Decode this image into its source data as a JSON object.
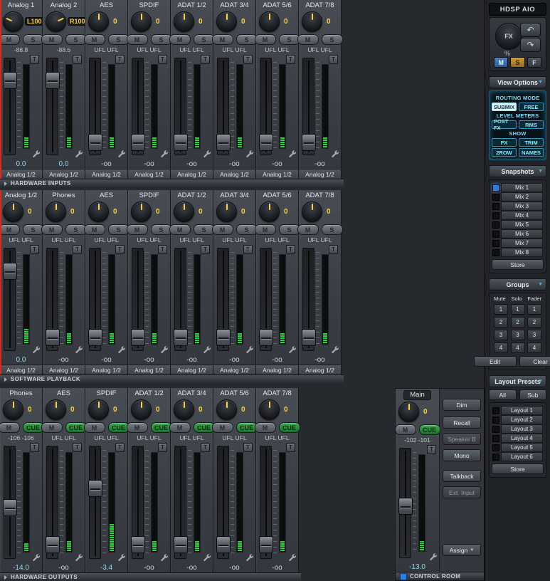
{
  "icons": {
    "dropdown": "▼",
    "undo": "↶",
    "redo": "↷"
  },
  "labels": {
    "trim": "T"
  },
  "colors": {
    "accent_cyan": "#35b6e0",
    "value_yellow": "#ffd23d",
    "gain_cyan": "#93d8ea",
    "cue_green": "#2f9a3f",
    "snapshot_led_blue": "#2f7fe0",
    "selection_red": "#cf2d1e"
  },
  "sidebar": {
    "device": "HDSP  AIO",
    "fx": {
      "label": "FX",
      "percent": "%"
    },
    "msf": [
      "M",
      "S",
      "F"
    ],
    "view_options": {
      "title": "View Options",
      "groups": [
        {
          "label": "ROUTING MODE",
          "buttons": [
            {
              "text": "SUBMIX",
              "active": true
            },
            {
              "text": "FREE"
            }
          ]
        },
        {
          "label": "LEVEL METERS",
          "buttons": [
            {
              "text": "POST FX"
            },
            {
              "text": "RMS"
            }
          ]
        },
        {
          "label": "SHOW",
          "buttons": [
            {
              "text": "FX"
            },
            {
              "text": "TRIM"
            },
            {
              "text": "2ROW"
            },
            {
              "text": "NAMES"
            }
          ]
        }
      ]
    },
    "snapshots": {
      "title": "Snapshots",
      "items": [
        "Mix 1",
        "Mix 2",
        "Mix 3",
        "Mix 4",
        "Mix 5",
        "Mix 6",
        "Mix 7",
        "Mix 8"
      ],
      "active_index": 0,
      "store": "Store"
    },
    "groups": {
      "title": "Groups",
      "columns": [
        "Mute",
        "Solo",
        "Fader"
      ],
      "rows": [
        "1",
        "2",
        "3",
        "4"
      ],
      "actions": [
        "Edit",
        "Clear"
      ]
    },
    "layout_presets": {
      "title": "Layout Presets",
      "filters": [
        "All",
        "Sub"
      ],
      "items": [
        "Layout 1",
        "Layout 2",
        "Layout 3",
        "Layout 4",
        "Layout 5",
        "Layout 6"
      ],
      "store": "Store"
    }
  },
  "sections": [
    {
      "header": "HARDWARE INPUTS",
      "channels": [
        {
          "name": "Analog 1",
          "knob": "L100",
          "buttons": [
            "M",
            "S"
          ],
          "level": "-88.8",
          "gain": "0.0",
          "out": "Analog 1/2",
          "fader_pos": 0.17,
          "meter": 0.13
        },
        {
          "name": "Analog 2",
          "knob": "R100",
          "buttons": [
            "M",
            "S"
          ],
          "level": "-88.5",
          "gain": "0.0",
          "out": "Analog 1/2",
          "fader_pos": 0.17,
          "meter": 0.13
        },
        {
          "name": "AES",
          "knob": "0",
          "buttons": [
            "M",
            "S"
          ],
          "level": "UFL UFL",
          "gain": "-oo",
          "out": "Analog 1/2",
          "fader_pos": 0.93,
          "meter": 0.12
        },
        {
          "name": "SPDIF",
          "knob": "0",
          "buttons": [
            "M",
            "S"
          ],
          "level": "UFL UFL",
          "gain": "-oo",
          "out": "Analog 1/2",
          "fader_pos": 0.93,
          "meter": 0.12
        },
        {
          "name": "ADAT 1/2",
          "knob": "0",
          "buttons": [
            "M",
            "S"
          ],
          "level": "UFL UFL",
          "gain": "-oo",
          "out": "Analog 1/2",
          "fader_pos": 0.93,
          "meter": 0.12
        },
        {
          "name": "ADAT 3/4",
          "knob": "0",
          "buttons": [
            "M",
            "S"
          ],
          "level": "UFL UFL",
          "gain": "-oo",
          "out": "Analog 1/2",
          "fader_pos": 0.93,
          "meter": 0.12
        },
        {
          "name": "ADAT 5/6",
          "knob": "0",
          "buttons": [
            "M",
            "S"
          ],
          "level": "UFL UFL",
          "gain": "-oo",
          "out": "Analog 1/2",
          "fader_pos": 0.93,
          "meter": 0.12
        },
        {
          "name": "ADAT 7/8",
          "knob": "0",
          "buttons": [
            "M",
            "S"
          ],
          "level": "UFL UFL",
          "gain": "-oo",
          "out": "Analog 1/2",
          "fader_pos": 0.93,
          "meter": 0.12
        }
      ]
    },
    {
      "header": "SOFTWARE PLAYBACK",
      "channels": [
        {
          "name": "Analog 1/2",
          "knob": "0",
          "buttons": [
            "M",
            "S"
          ],
          "level": "UFL UFL",
          "gain": "0.0",
          "out": "Analog 1/2",
          "fader_pos": 0.17,
          "meter": 0.16
        },
        {
          "name": "Phones",
          "knob": "0",
          "buttons": [
            "M",
            "S"
          ],
          "level": "UFL UFL",
          "gain": "-oo",
          "out": "Analog 1/2",
          "fader_pos": 0.93,
          "meter": 0.12
        },
        {
          "name": "AES",
          "knob": "0",
          "buttons": [
            "M",
            "S"
          ],
          "level": "UFL UFL",
          "gain": "-oo",
          "out": "Analog 1/2",
          "fader_pos": 0.93,
          "meter": 0.12
        },
        {
          "name": "SPDIF",
          "knob": "0",
          "buttons": [
            "M",
            "S"
          ],
          "level": "UFL UFL",
          "gain": "-oo",
          "out": "Analog 1/2",
          "fader_pos": 0.93,
          "meter": 0.12
        },
        {
          "name": "ADAT 1/2",
          "knob": "0",
          "buttons": [
            "M",
            "S"
          ],
          "level": "UFL UFL",
          "gain": "-oo",
          "out": "Analog 1/2",
          "fader_pos": 0.93,
          "meter": 0.12
        },
        {
          "name": "ADAT 3/4",
          "knob": "0",
          "buttons": [
            "M",
            "S"
          ],
          "level": "UFL UFL",
          "gain": "-oo",
          "out": "Analog 1/2",
          "fader_pos": 0.93,
          "meter": 0.12
        },
        {
          "name": "ADAT 5/6",
          "knob": "0",
          "buttons": [
            "M",
            "S"
          ],
          "level": "UFL UFL",
          "gain": "-oo",
          "out": "Analog 1/2",
          "fader_pos": 0.93,
          "meter": 0.12
        },
        {
          "name": "ADAT 7/8",
          "knob": "0",
          "buttons": [
            "M",
            "S"
          ],
          "level": "UFL UFL",
          "gain": "-oo",
          "out": "Analog 1/2",
          "fader_pos": 0.93,
          "meter": 0.12
        }
      ]
    },
    {
      "header": "HARDWARE OUTPUTS",
      "channels": [
        {
          "name": "Phones",
          "knob": "0",
          "buttons": [
            "M",
            "CUE"
          ],
          "level": "-106 -106",
          "gain": "-14.0",
          "fader_pos": 0.55,
          "meter": 0.08
        },
        {
          "name": "AES",
          "knob": "0",
          "buttons": [
            "M",
            "CUE"
          ],
          "level": "UFL UFL",
          "gain": "-oo",
          "fader_pos": 0.93,
          "meter": 0.1
        },
        {
          "name": "SPDIF",
          "knob": "0",
          "buttons": [
            "M",
            "CUE"
          ],
          "level": "UFL UFL",
          "gain": "-3.4",
          "fader_pos": 0.35,
          "meter": 0.27
        },
        {
          "name": "ADAT 1/2",
          "knob": "0",
          "buttons": [
            "M",
            "CUE"
          ],
          "level": "UFL UFL",
          "gain": "-oo",
          "fader_pos": 0.93,
          "meter": 0.1
        },
        {
          "name": "ADAT 3/4",
          "knob": "0",
          "buttons": [
            "M",
            "CUE"
          ],
          "level": "UFL UFL",
          "gain": "-oo",
          "fader_pos": 0.93,
          "meter": 0.1
        },
        {
          "name": "ADAT 5/6",
          "knob": "0",
          "buttons": [
            "M",
            "CUE"
          ],
          "level": "UFL UFL",
          "gain": "-oo",
          "fader_pos": 0.93,
          "meter": 0.1
        },
        {
          "name": "ADAT 7/8",
          "knob": "0",
          "buttons": [
            "M",
            "CUE"
          ],
          "level": "UFL UFL",
          "gain": "-oo",
          "fader_pos": 0.93,
          "meter": 0.1
        }
      ]
    }
  ],
  "control_room": {
    "header": "CONTROL ROOM",
    "channel": {
      "name": "Main",
      "knob": "0",
      "buttons": [
        "M",
        "CUE"
      ],
      "level": "-102 -101",
      "gain": "-13.0",
      "fader_pos": 0.52,
      "meter": 0.1
    },
    "buttons": [
      {
        "label": "Dim"
      },
      {
        "label": "Recall"
      },
      {
        "label": "Speaker B",
        "dim": true
      },
      {
        "label": "Mono"
      },
      {
        "label": "Talkback"
      },
      {
        "label": "Ext. Input",
        "dim": true
      }
    ],
    "assign_label": "Assign"
  }
}
